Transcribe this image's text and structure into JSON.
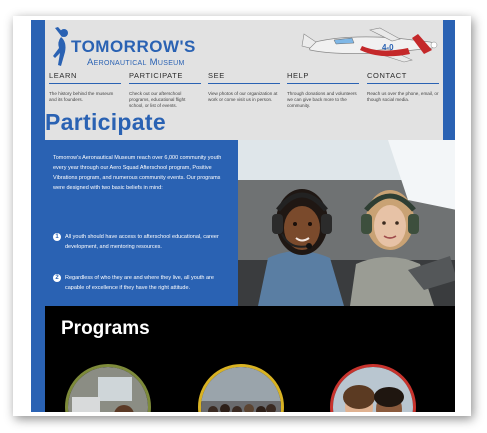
{
  "brand": {
    "name": "Tomorrow's",
    "subtitle": "Aeronautical Museum",
    "accent": "#2a62b3"
  },
  "nav": [
    {
      "label": "LEARN",
      "desc": "The history behind the museum and its founders."
    },
    {
      "label": "PARTICIPATE",
      "desc": "Check out our afterschool programs, educational flight school, or list of events."
    },
    {
      "label": "SEE",
      "desc": "View photos of our organization at work or come visit us in person."
    },
    {
      "label": "HELP",
      "desc": "Through donations and volunteers we can give back more to the community."
    },
    {
      "label": "CONTACT",
      "desc": "Reach us over the phone, email, or though social media."
    }
  ],
  "hero": {
    "title": "Participate"
  },
  "intro": {
    "text": "Tomorrow's Aeronautical Museum reach over 6,000 community youth every year through our Aero Squad Afterschool program, Positive Vibrations program, and numerous community events. Our programs were designed with two basic beliefs in mind:",
    "beliefs": [
      {
        "num": "1",
        "text": "All youth should have access to afterschool educational, career development, and mentoring resources."
      },
      {
        "num": "2",
        "text": "Regardless of who they are and where they live, all youth are capable of excellence if they have the right attitude."
      }
    ]
  },
  "programs": {
    "title": "Programs",
    "circles": [
      {
        "icon": "classroom-photo",
        "ring": "#7d8a3a"
      },
      {
        "icon": "group-photo",
        "ring": "#d8b223"
      },
      {
        "icon": "students-photo",
        "ring": "#c8332d"
      }
    ]
  }
}
